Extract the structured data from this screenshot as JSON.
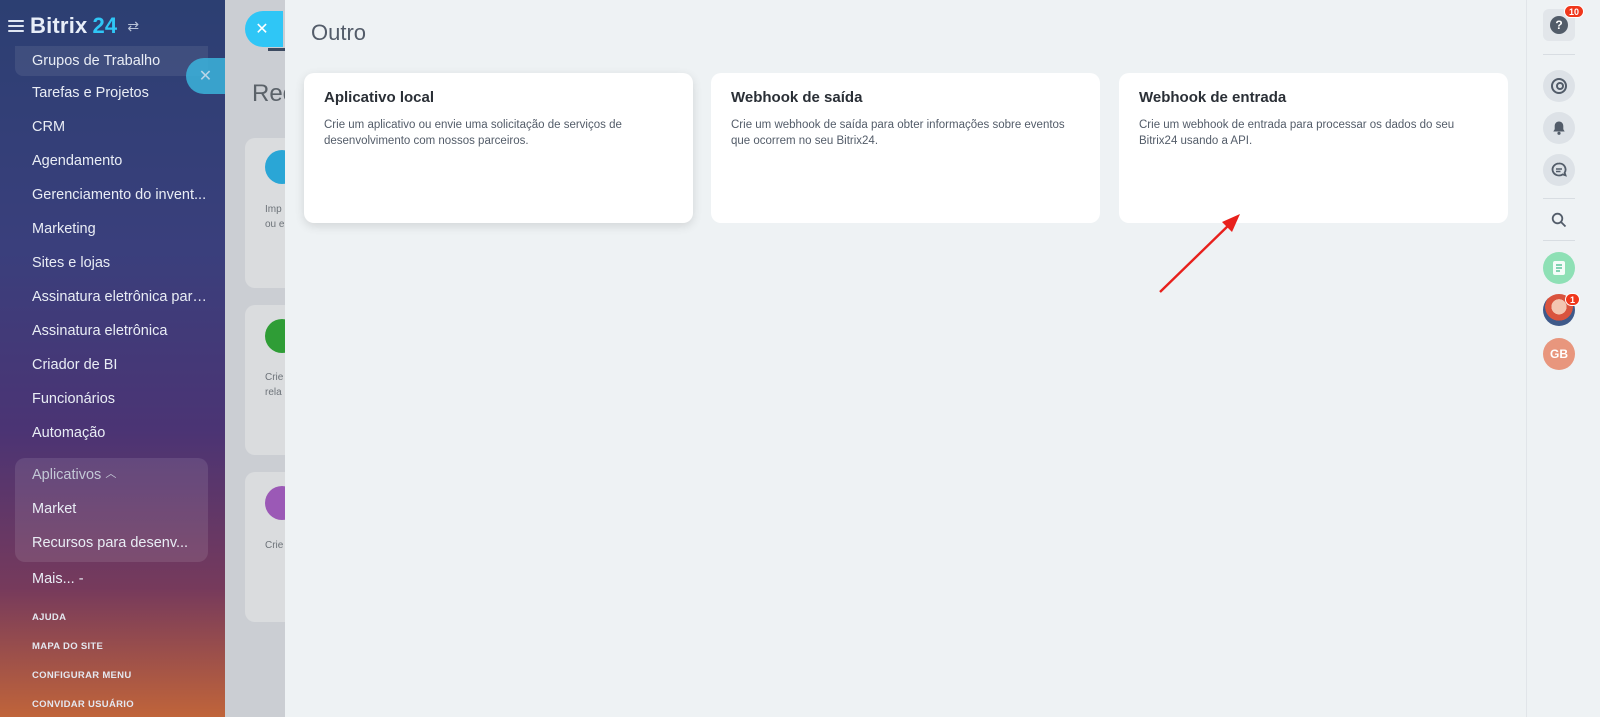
{
  "sidebar": {
    "brand_name": "Bitrix",
    "brand_num": "24",
    "menu": [
      "Grupos de Trabalho",
      "Tarefas e Projetos",
      "CRM",
      "Agendamento",
      "Gerenciamento do invent...",
      "Marketing",
      "Sites e lojas",
      "Assinatura eletrônica para...",
      "Assinatura eletrônica",
      "Criador de BI",
      "Funcionários",
      "Automação"
    ],
    "apps_group": {
      "label": "Aplicativos",
      "items": [
        "Market",
        "Recursos para desenv..."
      ]
    },
    "more_label": "Mais... -",
    "footer": [
      "AJUDA",
      "MAPA DO SITE",
      "CONFIGURAR MENU",
      "CONVIDAR USUÁRIO"
    ]
  },
  "background_page": {
    "title": "Rec",
    "snippets": [
      "Imp",
      "ou e",
      "Crie",
      "rela",
      "Crie"
    ]
  },
  "panel": {
    "title": "Outro",
    "cards": [
      {
        "title": "Aplicativo local",
        "desc": "Crie um aplicativo ou envie uma solicitação de serviços de desenvolvimento com nossos parceiros."
      },
      {
        "title": "Webhook de saída",
        "desc": "Crie um webhook de saída para obter informações sobre eventos que ocorrem no seu Bitrix24."
      },
      {
        "title": "Webhook de entrada",
        "desc": "Crie um webhook de entrada para processar os dados do seu Bitrix24 usando a API."
      }
    ]
  },
  "rightbar": {
    "help_badge": "10",
    "avatar_badge": "1",
    "user_initials": "GB"
  },
  "colors": {
    "accent": "#2fc6f6",
    "arrow": "#e8201c",
    "badge": "#f0371b"
  },
  "icons": {
    "close": "close-icon",
    "help": "question-icon",
    "copilot": "copilot-icon",
    "notifications": "bell-icon",
    "chat": "chat-icon",
    "search": "search-icon"
  }
}
